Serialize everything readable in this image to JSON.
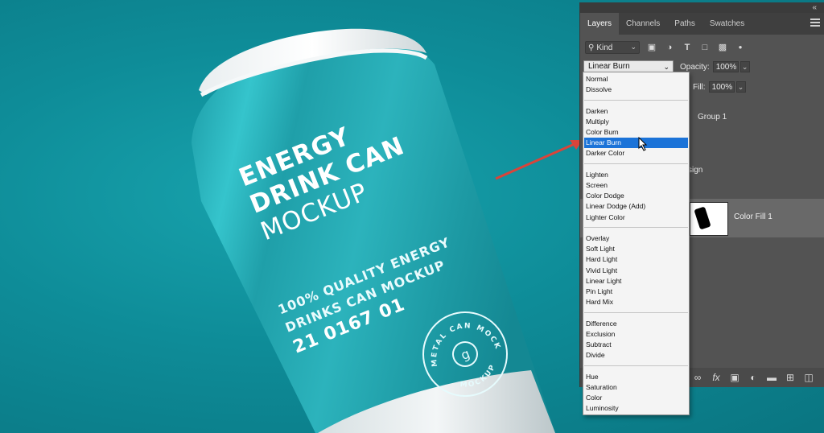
{
  "artwork": {
    "title_line1": "ENERGY",
    "title_line2": "DRINK CAN",
    "title_line3": "MOCKUP",
    "tagline_line1": "100% QUALITY ENERGY",
    "tagline_line2": "DRINKS CAN MOCKUP",
    "code": "21 0167 01",
    "badge_top": "METAL CAN MOCKUP",
    "badge_bottom": "MOCKUP",
    "badge_letter": "g",
    "background_color": "#0f8e9b",
    "can_color": "#2bb9c2",
    "arrow_color": "#d9443a"
  },
  "panel": {
    "collapse_icon": "double-chevron-icon",
    "tabs": [
      {
        "label": "Layers",
        "active": true
      },
      {
        "label": "Channels",
        "active": false
      },
      {
        "label": "Paths",
        "active": false
      },
      {
        "label": "Swatches",
        "active": false
      }
    ],
    "filter": {
      "kind_label": "Kind",
      "icons": [
        "image-filter-icon",
        "adjustment-filter-icon",
        "type-filter-icon",
        "shape-filter-icon",
        "smart-object-filter-icon",
        "filter-toggle-icon"
      ]
    },
    "blend_mode": "Linear Burn",
    "opacity_label": "Opacity:",
    "opacity_value": "100%",
    "fill_label": "Fill:",
    "fill_value": "100%",
    "layers": {
      "group_name": "Group 1",
      "design_partial": "sign",
      "color_fill_name": "Color Fill 1"
    },
    "bottom_icons": [
      "link-icon",
      "fx-icon",
      "mask-icon",
      "adjustment-icon",
      "folder-icon",
      "new-layer-icon",
      "trash-icon"
    ]
  },
  "dropdown": {
    "groups": [
      [
        "Normal",
        "Dissolve"
      ],
      [
        "Darken",
        "Multiply",
        "Color Burn",
        "Linear Burn",
        "Darker Color"
      ],
      [
        "Lighten",
        "Screen",
        "Color Dodge",
        "Linear Dodge (Add)",
        "Lighter Color"
      ],
      [
        "Overlay",
        "Soft Light",
        "Hard Light",
        "Vivid Light",
        "Linear Light",
        "Pin Light",
        "Hard Mix"
      ],
      [
        "Difference",
        "Exclusion",
        "Subtract",
        "Divide"
      ],
      [
        "Hue",
        "Saturation",
        "Color",
        "Luminosity"
      ]
    ],
    "selected": "Linear Burn",
    "selected_color": "#1b73d8"
  }
}
